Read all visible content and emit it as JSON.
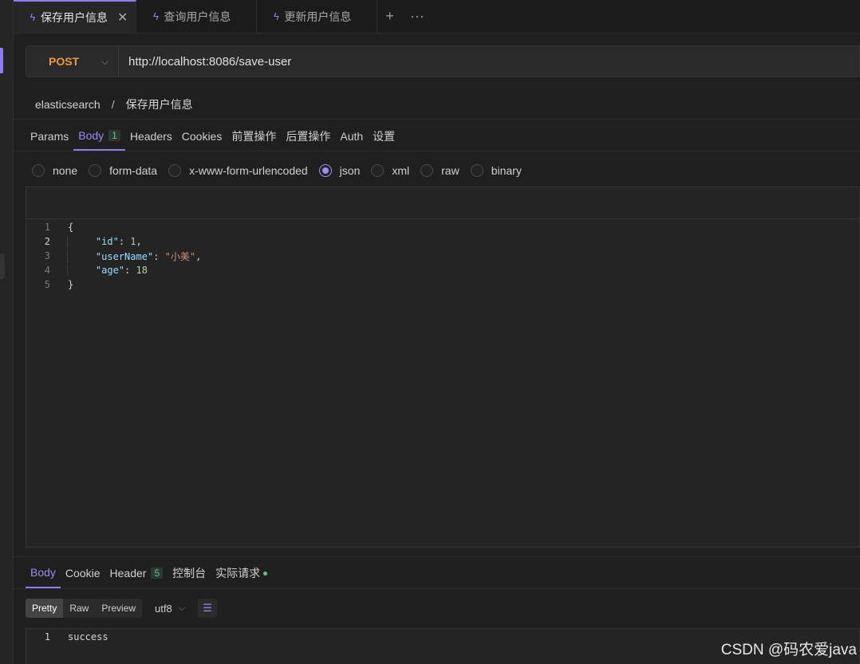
{
  "tabs": [
    {
      "label": "保存用户信息",
      "active": true
    },
    {
      "label": "查询用户信息",
      "active": false
    },
    {
      "label": "更新用户信息",
      "active": false
    }
  ],
  "request": {
    "method": "POST",
    "url": "http://localhost:8086/save-user"
  },
  "breadcrumb": {
    "folder": "elasticsearch",
    "separator": "/",
    "name": "保存用户信息"
  },
  "request_tabs": [
    {
      "label": "Params"
    },
    {
      "label": "Body",
      "count": "1",
      "active": true
    },
    {
      "label": "Headers"
    },
    {
      "label": "Cookies"
    },
    {
      "label": "前置操作"
    },
    {
      "label": "后置操作"
    },
    {
      "label": "Auth"
    },
    {
      "label": "设置"
    }
  ],
  "body_types": [
    {
      "label": "none"
    },
    {
      "label": "form-data"
    },
    {
      "label": "x-www-form-urlencoded"
    },
    {
      "label": "json",
      "checked": true
    },
    {
      "label": "xml"
    },
    {
      "label": "raw"
    },
    {
      "label": "binary"
    }
  ],
  "body_code": {
    "line1": "{",
    "line2_key": "\"id\"",
    "line2_val": "1",
    "line3_key": "\"userName\"",
    "line3_val": "\"小美\"",
    "line4_key": "\"age\"",
    "line4_val": "18",
    "line5": "}",
    "line_numbers": [
      "1",
      "2",
      "3",
      "4",
      "5"
    ]
  },
  "response_tabs": [
    {
      "label": "Body",
      "active": true
    },
    {
      "label": "Cookie"
    },
    {
      "label": "Header",
      "count": "5"
    },
    {
      "label": "控制台"
    },
    {
      "label": "实际请求",
      "dot": true
    }
  ],
  "response_view": {
    "modes": [
      "Pretty",
      "Raw",
      "Preview"
    ],
    "active_mode": "Pretty",
    "encoding": "utf8"
  },
  "response_body": {
    "line_number": "1",
    "text": "success"
  },
  "watermark": "CSDN @码农爱java",
  "colors": {
    "accent": "#8e7cf0",
    "method_post": "#e89b3f",
    "count_badge": "#5fc58f"
  }
}
